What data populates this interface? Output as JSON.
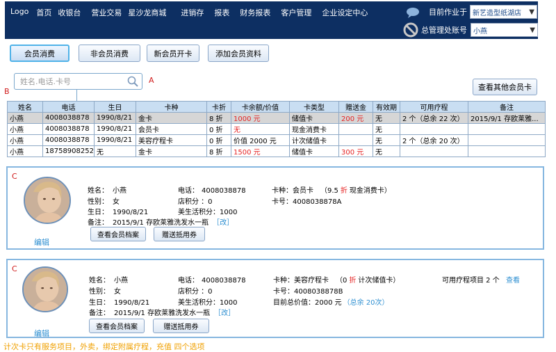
{
  "nav": {
    "items": [
      "Logo",
      "首页",
      "收银台",
      "营业交易",
      "星沙龙商城",
      "进销存",
      "报表",
      "财务报表",
      "客户管理",
      "企业设定中心"
    ],
    "current_work_label": "目前作业于",
    "current_store": "新艺造型纸湖店",
    "account_label": "总管理处账号",
    "account_value": "小燕"
  },
  "actions": {
    "member_consume": "会员消费",
    "non_member_consume": "非会员消费",
    "new_member_card": "新会员开卡",
    "add_member_info": "添加会员资料",
    "view_other_cards": "查看其他会员卡"
  },
  "search": {
    "placeholder": "姓名.电话.卡号"
  },
  "annotations": {
    "a": "A",
    "b": "B",
    "c1": "C",
    "c2": "C"
  },
  "table": {
    "headers": [
      "姓名",
      "电话",
      "生日",
      "卡种",
      "卡折",
      "卡余额/价值",
      "卡类型",
      "赠送金",
      "有效期",
      "可用疗程",
      "备注"
    ],
    "rows": [
      [
        "小燕",
        "4008038878",
        "1990/8/21",
        "金卡",
        "8 折",
        "1000 元",
        "储值卡",
        "200 元",
        "无",
        "2 个（总余 22 次）",
        "2015/9/1 存欧莱雅..."
      ],
      [
        "小燕",
        "4008038878",
        "1990/8/21",
        "会员卡",
        "0 折",
        "无",
        "现金消费卡",
        "",
        "无",
        "",
        ""
      ],
      [
        "小燕",
        "4008038878",
        "1990/8/21",
        "美容疗程卡",
        "0 折",
        "价值 2000 元",
        "计次储值卡",
        "",
        "无",
        "2 个（总余 20 次）",
        ""
      ],
      [
        "小燕",
        "18758908252",
        "无",
        "金卡",
        "8 折",
        "1500 元",
        "储值卡",
        "300 元",
        "无",
        "",
        ""
      ]
    ]
  },
  "card1": {
    "name_label": "姓名：",
    "name": "小燕",
    "gender_label": "性别：",
    "gender": "女",
    "birthday_label": "生日：",
    "birthday": "1990/8/21",
    "note_label": "备注：",
    "note": "2015/9/1   存欧莱雅洗发水一瓶",
    "edit_note": "［改］",
    "phone_label": "电话：",
    "phone": "4008038878",
    "points_label": "店积分 ：0",
    "beauty_points": "美生活积分：1000",
    "card_type_label": "卡种：会员卡",
    "discount_pre": "（9.5",
    "discount_unit": "折",
    "discount_post": "现金消费卡）",
    "card_no": "卡号：4008038878A",
    "view_profile": "查看会员档案",
    "gift_coupon": "赠送抵用券",
    "edit": "编辑"
  },
  "card2": {
    "name_label": "姓名：",
    "name": "小燕",
    "gender_label": "性别：",
    "gender": "女",
    "birthday_label": "生日：",
    "birthday": "1990/8/21",
    "note_label": "备注：",
    "note": "2015/9/1   存欧莱雅洗发水一瓶",
    "edit_note": "［改］",
    "phone_label": "电话：",
    "phone": "4008038878",
    "points_label": "店积分 ：0",
    "beauty_points": "美生活积分：1000",
    "card_type_label": "卡种：美容疗程卡",
    "discount_pre": "（0",
    "discount_unit": "折",
    "discount_post": "计次储值卡）",
    "card_no": "卡号：4008038878B",
    "total_value": "目前总价值：2000 元",
    "total_remaining": "（总余 20次）",
    "courses_label": "可用疗程项目 2 个",
    "view_link": "查看",
    "view_profile": "查看会员档案",
    "gift_coupon": "赠送抵用券",
    "edit": "编辑"
  },
  "footer": {
    "note": "计次卡只有服务项目，外卖，绑定附属疗程，充值 四个选项"
  },
  "colors": {
    "nav_bg": "#0d2f62",
    "header_bg": "#c9def2",
    "accent_red": "#e52222",
    "link_blue": "#2e8fd1"
  }
}
